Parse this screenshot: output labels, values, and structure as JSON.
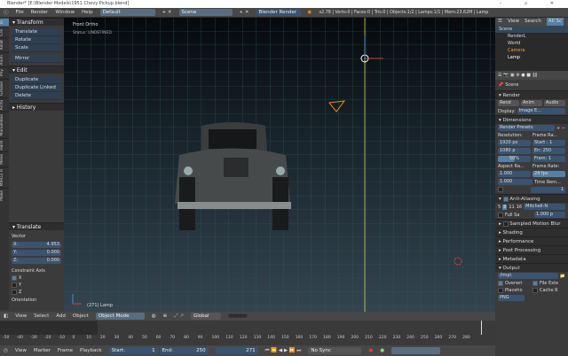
{
  "window": {
    "title": "Blender* [E:\\Blender Models\\1951 Chevy Pickup.blend]",
    "controls": "–  ▫  ✕"
  },
  "menu": [
    "File",
    "Render",
    "Window",
    "Help"
  ],
  "layout": "Default",
  "scene": "Scene",
  "engine": "Blender Render",
  "stats": "v2.78 | Verts:0 | Faces:0 | Tris:0 | Objects:1/2 | Lamps:1/1 | Mem:23.62M | Lamp",
  "left_tabs": [
    "To",
    "Cre",
    "Relat",
    "Anim",
    "Phy",
    "Grease",
    "Archi",
    "ManuelBas",
    "Hard",
    "Meas",
    "MIRO2 R",
    "Make"
  ],
  "toolshelf": {
    "transform": {
      "title": "Transform",
      "items": [
        "Translate",
        "Rotate",
        "Scale",
        "Mirror"
      ]
    },
    "edit": {
      "title": "Edit",
      "items": [
        "Duplicate",
        "Duplicate Linked",
        "Delete"
      ]
    },
    "history": {
      "title": "History"
    }
  },
  "redo": {
    "title": "Translate",
    "vector_label": "Vector",
    "x_label": "X:",
    "x": "4.953",
    "y_label": "Y:",
    "y": "0.000",
    "z_label": "Z:",
    "z": "0.000",
    "constraint_label": "Constraint Axis",
    "axes": [
      "X",
      "Y",
      "Z"
    ],
    "orientation": "Orientation"
  },
  "viewport": {
    "view_name": "Front Ortho",
    "status": "Status: UNDEFINED",
    "object_info": "(271) Lamp"
  },
  "outliner": {
    "view": "View",
    "search": "Search",
    "filter": "All Sc",
    "items": [
      "Scene",
      "RenderL",
      "World",
      "Camera",
      "Lamp"
    ]
  },
  "properties": {
    "breadcrumb": "Scene",
    "render": {
      "title": "Render",
      "buttons": [
        "Rend",
        "Anim",
        "Audio"
      ],
      "display_label": "Display:",
      "display": "Image E..."
    },
    "dimensions": {
      "title": "Dimensions",
      "presets": "Render Presets",
      "resolution_label": "Resolution:",
      "res_x": "1920 px",
      "res_y": "1080 p",
      "res_pct": "50%",
      "frame_range_label": "Frame Ra...",
      "start": "Start : 1",
      "end": "En: 250",
      "step": "Fram: 1",
      "aspect_label": "Aspect Ra...",
      "aspect_x": "1.000",
      "aspect_y": "1.000",
      "frame_rate_label": "Frame Rate:",
      "fps": "24 fps",
      "time_label": "Time Rem...",
      "time_val": "1"
    },
    "aa": {
      "title": "Anti-Aliasing",
      "samples": [
        "5",
        "8",
        "11",
        "16"
      ],
      "filter": "Mitchell-N",
      "full": "Full Sa",
      "size": "1.000 p"
    },
    "collapsed": [
      "Sampled Motion Blur",
      "Shading",
      "Performance",
      "Post Processing",
      "Metadata"
    ],
    "output": {
      "title": "Output",
      "path": "/tmp\\",
      "overwrite": "Overwri",
      "file_ext": "File Exte",
      "placeholders": "Placeho",
      "cache": "Cache R",
      "format": "PNG"
    }
  },
  "view3d_header": {
    "menus": [
      "View",
      "Select",
      "Add",
      "Object"
    ],
    "mode": "Object Mode",
    "orientation": "Global"
  },
  "timeline": {
    "ticks": [
      "-50",
      "-40",
      "-30",
      "-20",
      "-10",
      "0",
      "10",
      "20",
      "30",
      "40",
      "50",
      "60",
      "70",
      "80",
      "90",
      "100",
      "110",
      "120",
      "130",
      "140",
      "150",
      "160",
      "170",
      "180",
      "190",
      "200",
      "210",
      "220",
      "230",
      "240",
      "250",
      "260",
      "270",
      "280"
    ],
    "menus": [
      "View",
      "Marker",
      "Frame",
      "Playback"
    ],
    "start_label": "Start:",
    "start": "1",
    "end_label": "End:",
    "end": "250",
    "current": "271",
    "sync": "No Sync"
  },
  "colors": {
    "accent": "#5680a6",
    "field": "#3a5370"
  }
}
